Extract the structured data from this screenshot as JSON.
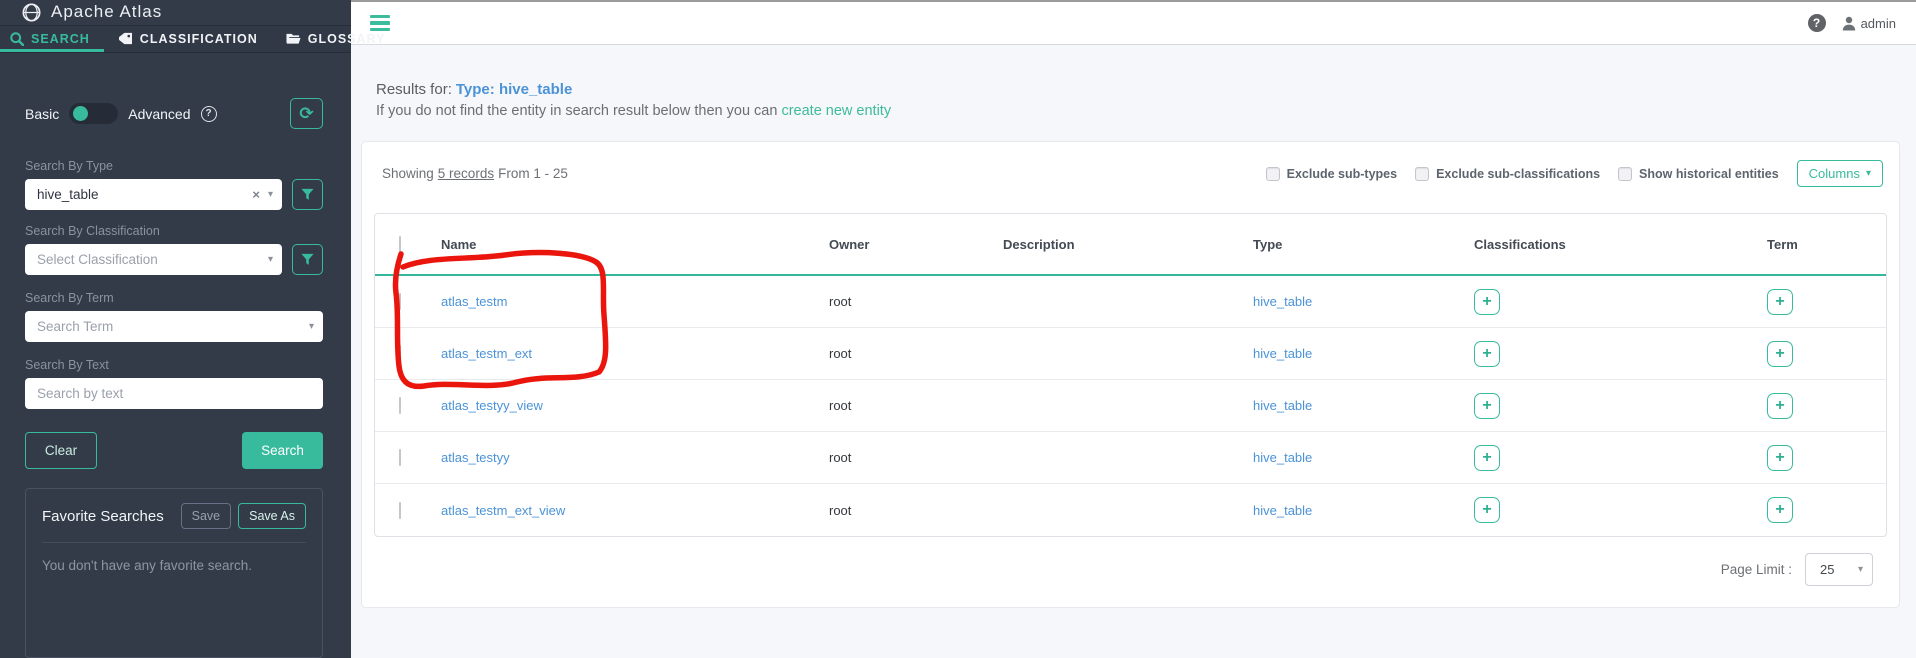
{
  "brand": {
    "title": "Apache Atlas"
  },
  "nav": {
    "tabs": [
      {
        "label": "SEARCH"
      },
      {
        "label": "CLASSIFICATION"
      },
      {
        "label": "GLOSSARY"
      }
    ]
  },
  "sidebar": {
    "mode": {
      "basic": "Basic",
      "advanced": "Advanced"
    },
    "fields": [
      {
        "label": "Search By Type",
        "value": "hive_table"
      },
      {
        "label": "Search By Classification",
        "placeholder": "Select Classification"
      },
      {
        "label": "Search By Term",
        "placeholder": "Search Term"
      },
      {
        "label": "Search By Text",
        "placeholder": "Search by text"
      }
    ],
    "buttons": {
      "clear": "Clear",
      "search": "Search"
    },
    "favorites": {
      "title": "Favorite Searches",
      "save": "Save",
      "save_as": "Save As",
      "empty": "You don't have any favorite search."
    }
  },
  "topbar": {
    "user": "admin"
  },
  "results": {
    "prefix": "Results for:",
    "type_label": "Type:",
    "type_value": "hive_table",
    "hint": "If you do not find the entity in search result below then you can",
    "hint_link": "create new entity",
    "showing_prefix": "Showing",
    "records_link": "5 records",
    "range": "From 1 - 25",
    "options": [
      {
        "label": "Exclude sub-types"
      },
      {
        "label": "Exclude sub-classifications"
      },
      {
        "label": "Show historical entities"
      }
    ],
    "columns_button": "Columns"
  },
  "table": {
    "headers": [
      "Name",
      "Owner",
      "Description",
      "Type",
      "Classifications",
      "Term"
    ],
    "rows": [
      {
        "name": "atlas_testm",
        "owner": "root",
        "description": "",
        "type": "hive_table"
      },
      {
        "name": "atlas_testm_ext",
        "owner": "root",
        "description": "",
        "type": "hive_table"
      },
      {
        "name": "atlas_testyy_view",
        "owner": "root",
        "description": "",
        "type": "hive_table"
      },
      {
        "name": "atlas_testyy",
        "owner": "root",
        "description": "",
        "type": "hive_table"
      },
      {
        "name": "atlas_testm_ext_view",
        "owner": "root",
        "description": "",
        "type": "hive_table"
      }
    ]
  },
  "pagination": {
    "label": "Page Limit :",
    "value": "25"
  },
  "icons": {
    "plus": "+",
    "caret_down": "▾",
    "clear_x": "×",
    "help": "?",
    "refresh": "⟳"
  },
  "colors": {
    "accent": "#38bb9c",
    "link_blue": "#4b93d6",
    "annotation_red": "#ea150c"
  }
}
